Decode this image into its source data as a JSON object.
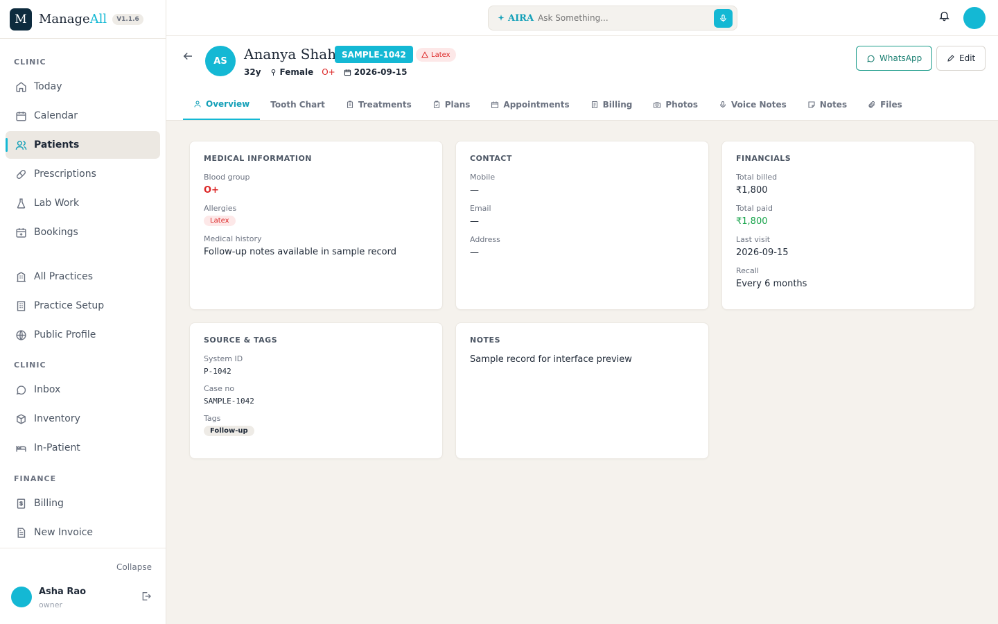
{
  "brand": {
    "logo_letter": "M",
    "name_part1": "Manage",
    "name_part2": "All",
    "version": "V1.1.6"
  },
  "sidebar": {
    "sections": [
      "CLINIC",
      "CLINIC",
      "FINANCE"
    ],
    "items": [
      {
        "label": "Today",
        "icon": "home-icon"
      },
      {
        "label": "Calendar",
        "icon": "calendar-icon"
      },
      {
        "label": "Patients",
        "icon": "users-icon",
        "active": true
      },
      {
        "label": "Prescriptions",
        "icon": "pill-icon"
      },
      {
        "label": "Lab Work",
        "icon": "flask-icon"
      },
      {
        "label": "Bookings",
        "icon": "calendar-plus-icon"
      },
      {
        "label": "All Practices",
        "icon": "building-icon"
      },
      {
        "label": "Practice Setup",
        "icon": "office-icon"
      },
      {
        "label": "Public Profile",
        "icon": "globe-icon"
      },
      {
        "label": "Inbox",
        "icon": "whatsapp-icon"
      },
      {
        "label": "Inventory",
        "icon": "box-icon"
      },
      {
        "label": "In-Patient",
        "icon": "bed-icon"
      },
      {
        "label": "Billing",
        "icon": "receipt-icon"
      },
      {
        "label": "New Invoice",
        "icon": "invoice-icon"
      }
    ],
    "collapse_label": "Collapse",
    "user": {
      "name": "Asha Rao",
      "role": "owner"
    }
  },
  "topbar": {
    "aira_label": "AIRA",
    "aira_placeholder": "Ask Something..."
  },
  "patient": {
    "initials": "AS",
    "name": "Ananya Shah",
    "case_badge": "SAMPLE-1042",
    "allergy_badge": "Latex",
    "age": "32y",
    "gender": "Female",
    "blood": "O+",
    "date": "2026-09-15",
    "whatsapp_label": "WhatsApp",
    "edit_label": "Edit"
  },
  "tabs": [
    {
      "label": "Overview",
      "active": true
    },
    {
      "label": "Tooth Chart"
    },
    {
      "label": "Treatments"
    },
    {
      "label": "Plans"
    },
    {
      "label": "Appointments"
    },
    {
      "label": "Billing"
    },
    {
      "label": "Photos"
    },
    {
      "label": "Voice Notes"
    },
    {
      "label": "Notes"
    },
    {
      "label": "Files"
    }
  ],
  "medical": {
    "title": "MEDICAL INFORMATION",
    "blood_label": "Blood group",
    "blood_value": "O+",
    "allergies_label": "Allergies",
    "allergies_value": "Latex",
    "history_label": "Medical history",
    "history_value": "Follow-up notes available in sample record"
  },
  "contact": {
    "title": "CONTACT",
    "mobile_label": "Mobile",
    "mobile_value": "—",
    "email_label": "Email",
    "email_value": "—",
    "address_label": "Address",
    "address_value": "—"
  },
  "financials": {
    "title": "FINANCIALS",
    "billed_label": "Total billed",
    "billed_value": "₹1,800",
    "paid_label": "Total paid",
    "paid_value": "₹1,800",
    "last_visit_label": "Last visit",
    "last_visit_value": "2026-09-15",
    "recall_label": "Recall",
    "recall_value": "Every 6 months"
  },
  "source": {
    "title": "SOURCE & TAGS",
    "system_id_label": "System ID",
    "system_id_value": "P-1042",
    "case_label": "Case no",
    "case_value": "SAMPLE-1042",
    "tags_label": "Tags",
    "tag": "Follow-up"
  },
  "notes": {
    "title": "NOTES",
    "text": "Sample record for interface preview"
  }
}
